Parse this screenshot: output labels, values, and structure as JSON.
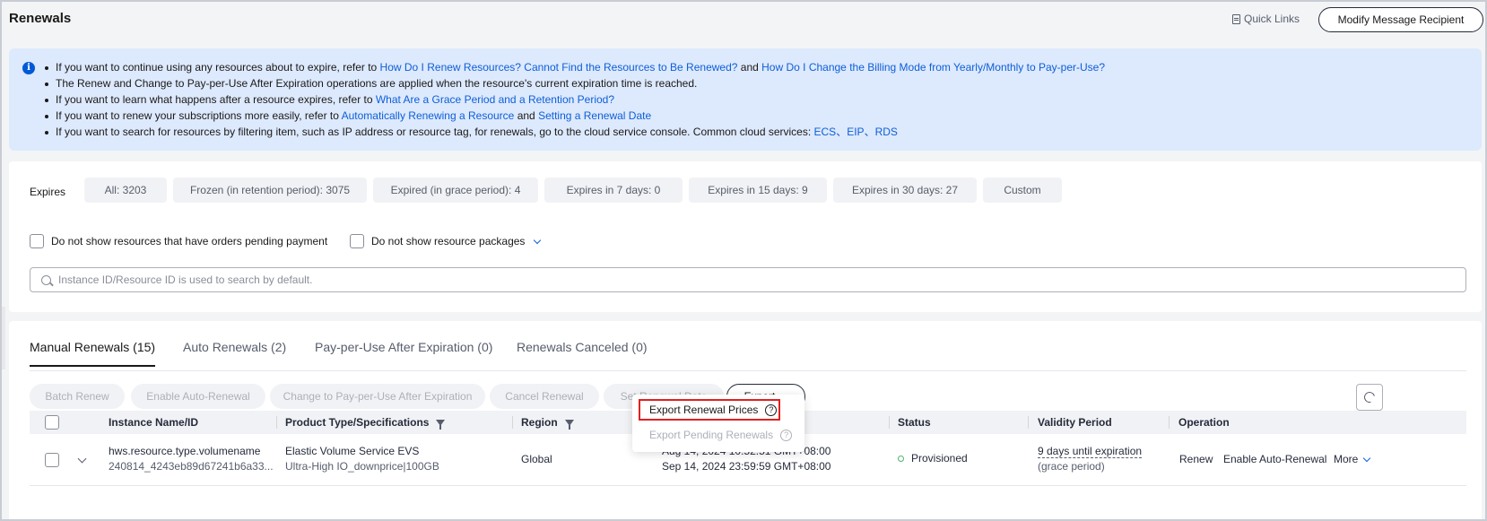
{
  "header": {
    "title": "Renewals",
    "quick_links": "Quick Links",
    "modify_button": "Modify Message Recipient"
  },
  "info": {
    "line1": {
      "text1": "If you want to continue using any resources about to expire, refer to ",
      "link1": "How Do I Renew Resources? Cannot Find the Resources to Be Renewed?",
      "text2": " and ",
      "link2": "How Do I Change the Billing Mode from Yearly/Monthly to Pay-per-Use?"
    },
    "line2": {
      "text1": "The Renew and Change to Pay-per-Use After Expiration operations are applied when the resource's current expiration time is reached."
    },
    "line3": {
      "text1": "If you want to learn what happens after a resource expires, refer to ",
      "link1": "What Are a Grace Period and a Retention Period?"
    },
    "line4": {
      "text1": "If you want to renew your subscriptions more easily, refer to ",
      "link1": "Automatically Renewing a Resource",
      "text2": " and ",
      "link2": "Setting a Renewal Date"
    },
    "line5": {
      "text1": "If you want to search for resources by filtering item, such as IP address or resource tag, for renewals, go to the cloud service console. Common cloud services:  ",
      "link1": "ECS",
      "sep1": "、",
      "link2": "EIP",
      "sep2": "、",
      "link3": "RDS"
    }
  },
  "filters": {
    "expires_label": "Expires",
    "chips": [
      "All: 3203",
      "Frozen (in retention period): 3075",
      "Expired (in grace period): 4",
      "Expires in 7 days: 0",
      "Expires in 15 days: 9",
      "Expires in 30 days: 27",
      "Custom"
    ],
    "check_pending": "Do not show resources that have orders pending payment",
    "check_packages": "Do not show resource packages",
    "search_placeholder": "Instance ID/Resource ID is used to search by default."
  },
  "tabs": [
    "Manual Renewals (15)",
    "Auto Renewals (2)",
    "Pay-per-Use After Expiration (0)",
    "Renewals Canceled (0)"
  ],
  "toolbar": {
    "batch_renew": "Batch Renew",
    "enable_auto": "Enable Auto-Renewal",
    "change_ppu": "Change to Pay-per-Use After Expiration",
    "cancel_renewal": "Cancel Renewal",
    "set_date": "Set Renewal Date",
    "export": "Export"
  },
  "export_menu": {
    "renewal_prices": "Export Renewal Prices",
    "pending_renewals": "Export Pending Renewals"
  },
  "table": {
    "columns": {
      "instance": "Instance Name/ID",
      "product": "Product Type/Specifications",
      "region": "Region",
      "status": "Status",
      "validity": "Validity Period",
      "operation": "Operation"
    },
    "rows": [
      {
        "name": "hws.resource.type.volumename",
        "id": "240814_4243eb89d67241b6a33...",
        "product": "Elastic Volume Service EVS",
        "spec": "Ultra-High IO_downprice|100GB",
        "region": "Global",
        "start": "Aug 14, 2024 10:52:51 GMT+08:00",
        "end": "Sep 14, 2024 23:59:59 GMT+08:00",
        "status": "Provisioned",
        "validity": "9 days until expiration",
        "validity_sub": "(grace period)",
        "op_renew": "Renew",
        "op_auto": "Enable Auto-Renewal",
        "op_more": "More"
      }
    ]
  },
  "colors": {
    "link": "#0d5fd9",
    "banner": "#dde9fc",
    "status_ok": "#50b371",
    "highlight": "#e02020"
  }
}
